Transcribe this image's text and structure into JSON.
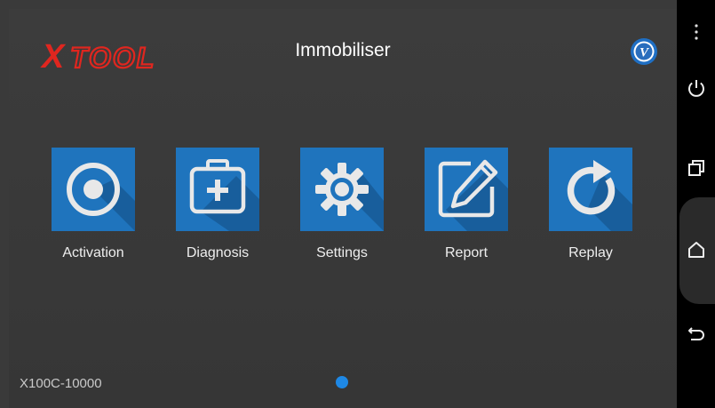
{
  "app": {
    "logo_text": "XTOOL",
    "title": "Immobiliser",
    "serial": "X100C-10000",
    "vci_badge_letter": "V"
  },
  "tiles": [
    {
      "label": "Activation",
      "icon": "target-icon"
    },
    {
      "label": "Diagnosis",
      "icon": "first-aid-kit-icon"
    },
    {
      "label": "Settings",
      "icon": "gear-icon"
    },
    {
      "label": "Report",
      "icon": "edit-document-icon"
    },
    {
      "label": "Replay",
      "icon": "refresh-icon"
    }
  ],
  "pager": {
    "pages": 1,
    "current": 1
  },
  "navbar": [
    "more-options-icon",
    "power-icon",
    "recent-apps-icon",
    "home-icon",
    "back-icon"
  ],
  "colors": {
    "accent": "#1f74bd",
    "logo_red": "#e0261f",
    "dot": "#1e88e5",
    "background": "#3a3a3a"
  }
}
